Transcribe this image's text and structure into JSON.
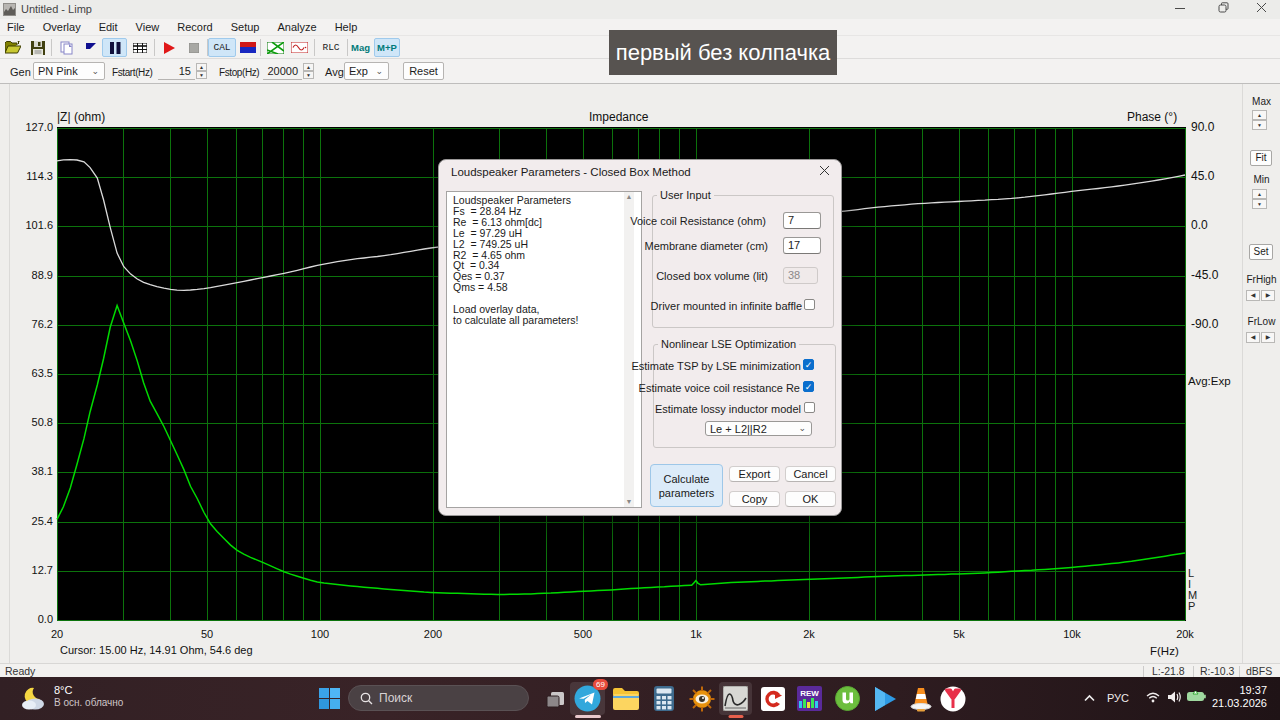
{
  "titlebar": {
    "title": "Untitled - Limp"
  },
  "menu": {
    "items": [
      "File",
      "Overlay",
      "Edit",
      "View",
      "Record",
      "Setup",
      "Analyze",
      "Help"
    ]
  },
  "toolbar": {
    "cal_label": "CAL",
    "rlc_label": "RLC",
    "mag_label": "Mag",
    "mp_label": "M+P"
  },
  "controls": {
    "gen_label": "Gen",
    "gen_value": "PN Pink",
    "fstart_label": "Fstart(Hz)",
    "fstart_value": "15",
    "fstop_label": "Fstop(Hz)",
    "fstop_value": "20000",
    "avg_label": "Avg",
    "avg_value": "Exp",
    "reset_label": "Reset"
  },
  "caption": {
    "text": "первый без колпачка"
  },
  "chart": {
    "ylabel": "|Z| (ohm)",
    "title": "Impedance",
    "y2label": "Phase (°)",
    "xunit": "F(Hz)",
    "cursor_text": "Cursor: 15.00 Hz, 14.91 Ohm, 54.6 deg",
    "logo": "LIMP",
    "avg_display": "Avg:Exp"
  },
  "chart_data": {
    "type": "line",
    "x_scale": "log",
    "x_range": [
      20,
      20000
    ],
    "x_ticks": [
      "20",
      "50",
      "100",
      "200",
      "500",
      "1k",
      "2k",
      "5k",
      "10k",
      "20k"
    ],
    "x_tick_values": [
      20,
      50,
      100,
      200,
      500,
      1000,
      2000,
      5000,
      10000,
      20000
    ],
    "y_left": {
      "label": "|Z| (ohm)",
      "range": [
        0,
        127
      ],
      "ticks": [
        "127.0",
        "114.3",
        "101.6",
        "88.9",
        "76.2",
        "63.5",
        "50.8",
        "38.1",
        "25.4",
        "12.7",
        "0.0"
      ]
    },
    "y_right": {
      "label": "Phase (°)",
      "ticks": [
        "90.0",
        "45.0",
        "0.0",
        "-45.0",
        "-90.0"
      ],
      "deg_span_per_grid": 45
    },
    "grid_color": "#0c730c",
    "background": "#000000",
    "series": [
      {
        "name": "impedance_ohm",
        "axis": "left",
        "color": "#00da00",
        "x": [
          20.0,
          20.8,
          21.7,
          22.6,
          23.6,
          24.5,
          25.6,
          26.6,
          27.7,
          28.9,
          30.1,
          31.4,
          32.7,
          34.0,
          35.4,
          36.9,
          38.5,
          40.1,
          41.7,
          43.5,
          45.3,
          47.2,
          49.2,
          51.2,
          53.3,
          55.6,
          57.9,
          60.3,
          62.8,
          65.4,
          68.2,
          71.0,
          74.0,
          77.1,
          80.3,
          83.6,
          87.1,
          90.7,
          94.5,
          98.5,
          102.6,
          106.9,
          111.3,
          116.0,
          120.8,
          125.8,
          131.1,
          136.6,
          142.3,
          148.2,
          154.4,
          160.8,
          167.5,
          174.5,
          181.8,
          189.4,
          197.3,
          205.5,
          214.1,
          223.0,
          232.3,
          242.0,
          252.1,
          262.6,
          273.6,
          285.0,
          296.9,
          309.3,
          322.2,
          335.6,
          349.7,
          364.2,
          379.4,
          395.3,
          411.8,
          428.9,
          446.8,
          465.5,
          484.9,
          505.1,
          526.2,
          548.2,
          571.0,
          594.8,
          619.7,
          645.5,
          672.4,
          700.5,
          729.7,
          760.2,
          791.9,
          824.9,
          859.3,
          895.2,
          932.5,
          971.5,
          975.0,
          992.0,
          1000.0,
          1008.0,
          1012.0,
          1030.0,
          1054.2,
          1098.2,
          1144.0,
          1191.7,
          1241.5,
          1293.2,
          1347.2,
          1403.4,
          1462.0,
          1523.0,
          1586.5,
          1652.7,
          1721.6,
          1793.5,
          1868.3,
          1946.2,
          2027.4,
          2112.0,
          2200.1,
          2291.9,
          2387.6,
          2487.2,
          2590.9,
          2699.0,
          2811.6,
          2928.9,
          3051.1,
          3178.4,
          3311.0,
          3449.2,
          3593.1,
          3743.0,
          3899.2,
          4061.8,
          4231.3,
          4407.8,
          4591.7,
          4783.3,
          4982.9,
          5190.8,
          5407.3,
          5632.9,
          5867.9,
          6112.8,
          6367.8,
          6633.5,
          6910.2,
          7198.5,
          7498.8,
          7811.7,
          8137.6,
          8477.1,
          8830.8,
          9199.2,
          9583.0,
          9982.9,
          10399.4,
          10833.2,
          11285.2,
          11756.0,
          12246.5,
          12757.4,
          13289.7,
          13844.2,
          14421.8,
          15023.4,
          15650.2,
          16303.2,
          16983.4,
          17691.9,
          18430.1,
          19199.0,
          20000.0
        ],
        "values": [
          26.0,
          29.22,
          34.08,
          40.22,
          46.87,
          53.78,
          60.66,
          67.49,
          75.56,
          81.19,
          76.61,
          71.94,
          66.82,
          61.24,
          56.49,
          53.26,
          49.94,
          46.25,
          42.72,
          38.83,
          34.52,
          31.36,
          27.74,
          24.84,
          22.84,
          21.05,
          19.33,
          17.96,
          16.99,
          16.17,
          15.46,
          14.74,
          13.96,
          13.18,
          12.45,
          11.84,
          11.31,
          10.8,
          10.27,
          9.83,
          9.54,
          9.34,
          9.14,
          8.95,
          8.77,
          8.61,
          8.46,
          8.32,
          8.18,
          8.04,
          7.9,
          7.76,
          7.63,
          7.5,
          7.37,
          7.24,
          7.13,
          7.05,
          6.99,
          6.93,
          6.88,
          6.84,
          6.79,
          6.73,
          6.67,
          6.63,
          6.6,
          6.61,
          6.63,
          6.66,
          6.7,
          6.75,
          6.81,
          6.88,
          6.95,
          7.04,
          7.14,
          7.23,
          7.33,
          7.42,
          7.51,
          7.6,
          7.69,
          7.78,
          7.88,
          7.99,
          8.1,
          8.2,
          8.3,
          8.38,
          8.48,
          8.58,
          8.69,
          8.79,
          8.87,
          8.95,
          8.97,
          9.77,
          10.15,
          9.81,
          9.53,
          9.09,
          9.16,
          9.31,
          9.46,
          9.58,
          9.67,
          9.75,
          9.82,
          9.89,
          9.96,
          10.03,
          10.1,
          10.17,
          10.24,
          10.32,
          10.39,
          10.45,
          10.52,
          10.59,
          10.65,
          10.71,
          10.77,
          10.84,
          10.92,
          11.0,
          11.08,
          11.16,
          11.23,
          11.29,
          11.35,
          11.4,
          11.46,
          11.51,
          11.57,
          11.62,
          11.67,
          11.73,
          11.78,
          11.84,
          11.89,
          11.96,
          12.02,
          12.08,
          12.16,
          12.24,
          12.34,
          12.46,
          12.57,
          12.66,
          12.75,
          12.84,
          12.95,
          13.06,
          13.18,
          13.32,
          13.45,
          13.59,
          13.74,
          13.89,
          14.05,
          14.22,
          14.39,
          14.56,
          14.74,
          14.94,
          15.16,
          15.4,
          15.66,
          15.93,
          16.19,
          16.46,
          16.74,
          17.01,
          17.3
        ]
      },
      {
        "name": "phase_deg",
        "axis": "right",
        "color": "#dadada",
        "x": [
          20.0,
          20.8,
          21.7,
          22.6,
          23.6,
          24.5,
          25.6,
          26.6,
          27.7,
          28.9,
          30.1,
          31.4,
          32.7,
          34.0,
          35.4,
          36.9,
          38.5,
          40.1,
          41.7,
          43.5,
          45.3,
          47.2,
          49.2,
          51.2,
          53.3,
          55.6,
          57.9,
          60.3,
          62.8,
          65.4,
          68.2,
          71.0,
          74.0,
          77.1,
          80.3,
          83.6,
          87.1,
          90.7,
          94.5,
          98.5,
          102.6,
          106.9,
          111.3,
          116.0,
          120.8,
          125.8,
          131.1,
          136.6,
          142.3,
          148.2,
          154.4,
          160.8,
          167.5,
          174.5,
          181.8,
          189.4,
          197.3,
          205.5,
          214.1,
          223.0,
          232.3,
          242.0,
          252.1,
          262.6,
          273.6,
          285.0,
          296.9,
          309.3,
          322.2,
          335.6,
          349.7,
          364.2,
          379.4,
          395.3,
          411.8,
          428.9,
          446.8,
          465.5,
          484.9,
          505.1,
          526.2,
          548.2,
          571.0,
          594.8,
          619.7,
          645.5,
          672.4,
          700.5,
          729.7,
          760.2,
          791.9,
          824.9,
          859.3,
          895.2,
          932.5,
          971.5,
          975.0,
          992.0,
          1000.0,
          1008.0,
          1012.0,
          1030.0,
          1054.2,
          1098.2,
          1144.0,
          1191.7,
          1241.5,
          1293.2,
          1347.2,
          1403.4,
          1462.0,
          1523.0,
          1586.5,
          1652.7,
          1721.6,
          1793.5,
          1868.3,
          1946.2,
          2027.4,
          2112.0,
          2200.1,
          2291.9,
          2387.6,
          2487.2,
          2590.9,
          2699.0,
          2811.6,
          2928.9,
          3051.1,
          3178.4,
          3311.0,
          3449.2,
          3593.1,
          3743.0,
          3899.2,
          4061.8,
          4231.3,
          4407.8,
          4591.7,
          4783.3,
          4982.9,
          5190.8,
          5407.3,
          5632.9,
          5867.9,
          6112.8,
          6367.8,
          6633.5,
          6910.2,
          7198.5,
          7498.8,
          7811.7,
          8137.6,
          8477.1,
          8830.8,
          9199.2,
          9583.0,
          9982.9,
          10399.4,
          10833.2,
          11285.2,
          11756.0,
          12246.5,
          12757.4,
          13289.7,
          13844.2,
          14421.8,
          15023.4,
          15650.2,
          16303.2,
          16983.4,
          17691.9,
          18430.1,
          19199.0,
          20000.0
        ],
        "values": [
          60.0,
          60.79,
          60.99,
          60.72,
          59.03,
          53.77,
          44.15,
          24.11,
          -0.8,
          -24.45,
          -36.84,
          -43.59,
          -48.14,
          -51.12,
          -53.31,
          -55.04,
          -56.5,
          -57.53,
          -58.27,
          -58.48,
          -58.16,
          -57.65,
          -56.86,
          -55.95,
          -54.85,
          -53.72,
          -52.54,
          -51.36,
          -50.17,
          -48.98,
          -47.78,
          -46.58,
          -45.38,
          -44.16,
          -42.89,
          -41.54,
          -40.14,
          -38.71,
          -37.17,
          -35.69,
          -34.44,
          -33.29,
          -32.23,
          -31.25,
          -30.36,
          -29.57,
          -28.87,
          -28.2,
          -27.51,
          -26.75,
          -25.86,
          -24.87,
          -23.82,
          -22.77,
          -21.75,
          -20.71,
          -19.76,
          -19.05,
          -18.46,
          -17.95,
          -17.46,
          -16.95,
          -16.37,
          -15.73,
          -15.04,
          -14.35,
          -13.67,
          -13.01,
          -12.37,
          -11.73,
          -11.09,
          -10.46,
          -9.82,
          -9.19,
          -8.54,
          -7.9,
          -7.25,
          -6.61,
          -5.97,
          -5.34,
          -4.73,
          -4.12,
          -3.51,
          -2.91,
          -2.31,
          -1.71,
          -1.1,
          -0.49,
          0.14,
          0.79,
          1.44,
          2.1,
          2.75,
          3.39,
          4.01,
          4.6,
          4.65,
          4.89,
          5.0,
          5.11,
          5.16,
          5.4,
          5.7,
          6.24,
          6.77,
          7.28,
          7.78,
          8.26,
          8.72,
          9.15,
          9.56,
          9.94,
          10.28,
          10.6,
          10.9,
          11.19,
          11.49,
          11.79,
          12.11,
          12.41,
          12.71,
          13.05,
          13.44,
          13.97,
          14.64,
          15.41,
          16.19,
          16.92,
          17.55,
          18.14,
          18.72,
          19.27,
          19.8,
          20.29,
          20.74,
          21.15,
          21.51,
          21.84,
          22.15,
          22.45,
          22.77,
          23.1,
          23.43,
          23.76,
          24.1,
          24.47,
          24.83,
          25.22,
          25.65,
          26.16,
          26.75,
          27.41,
          28.09,
          28.83,
          29.61,
          30.41,
          31.21,
          31.97,
          32.68,
          33.37,
          34.04,
          34.71,
          35.41,
          36.14,
          36.93,
          37.76,
          38.64,
          39.54,
          40.48,
          41.45,
          42.47,
          43.54,
          44.64,
          45.8,
          47.0
        ]
      }
    ]
  },
  "side_panel": {
    "max_label": "Max",
    "fit_label": "Fit",
    "min_label": "Min",
    "set_label": "Set",
    "frhigh_label": "FrHigh",
    "frlow_label": "FrLow"
  },
  "dialog": {
    "title": "Loudspeaker Parameters - Closed Box Method",
    "results_text": "Loudspeaker Parameters\nFs  = 28.84 Hz\nRe  = 6.13 ohm[dc]\nLe  = 97.29 uH\nL2  = 749.25 uH\nR2  = 4.65 ohm\nQt  = 0.34\nQes = 0.37\nQms = 4.58\n\nLoad overlay data,\nto calculate all parameters!",
    "user_input": {
      "legend": "User Input",
      "voice_coil_label": "Voice coil Resistance (ohm)",
      "voice_coil_value": "7",
      "membrane_label": "Membrane diameter (cm)",
      "membrane_value": "17",
      "closed_box_label": "Closed box volume (lit)",
      "closed_box_value": "38",
      "baffle_label": "Driver mounted in infinite baffle"
    },
    "lse": {
      "legend": "Nonlinear LSE Optimization",
      "check1": "Estimate TSP by LSE minimization",
      "check2": "Estimate voice coil resistance Re",
      "check3": "Estimate lossy inductor model",
      "model_value": "Le + L2||R2"
    },
    "buttons": {
      "calculate": "Calculate\nparameters",
      "export": "Export",
      "cancel": "Cancel",
      "copy": "Copy",
      "ok": "OK"
    }
  },
  "statusbar": {
    "ready": "Ready",
    "left_level": "L:-21.8",
    "right_level": "R:-10.3",
    "unit": "dBFS"
  },
  "taskbar": {
    "weather_temp": "8°C",
    "weather_desc": "В осн. облачно",
    "search_placeholder": "Поиск",
    "telegram_badge": "69",
    "lang": "РУС",
    "time": "19:37",
    "date": "21.03.2026"
  }
}
